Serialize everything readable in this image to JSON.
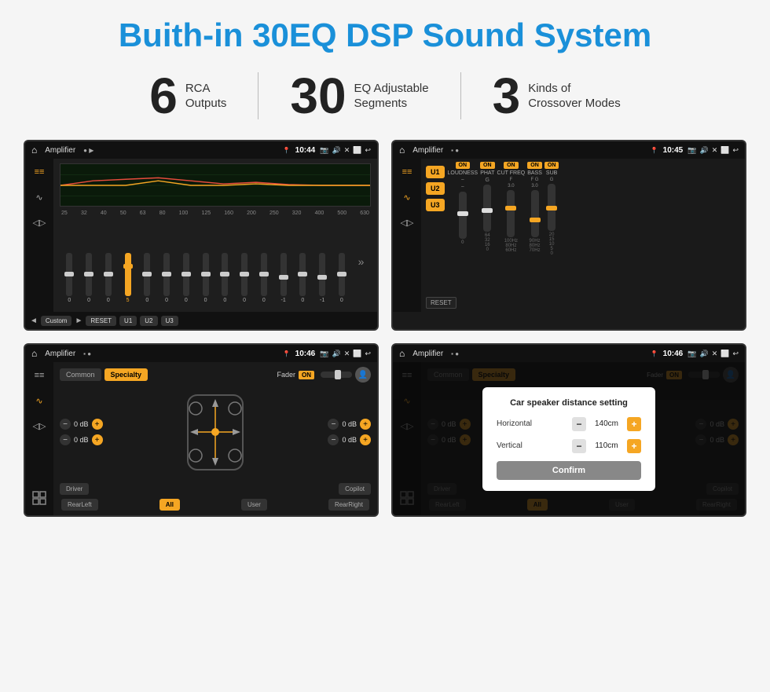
{
  "title": "Buith-in 30EQ DSP Sound System",
  "stats": [
    {
      "number": "6",
      "label": "RCA\nOutputs"
    },
    {
      "number": "30",
      "label": "EQ Adjustable\nSegments"
    },
    {
      "number": "3",
      "label": "Kinds of\nCrossover Modes"
    }
  ],
  "screens": [
    {
      "id": "eq-screen",
      "statusbar": {
        "app": "Amplifier",
        "time": "10:44"
      },
      "eq": {
        "freqs": [
          "25",
          "32",
          "40",
          "50",
          "63",
          "80",
          "100",
          "125",
          "160",
          "200",
          "250",
          "320",
          "400",
          "500",
          "630"
        ],
        "values": [
          "0",
          "0",
          "0",
          "5",
          "0",
          "0",
          "0",
          "0",
          "0",
          "0",
          "0",
          "-1",
          "0",
          "-1"
        ],
        "bottomBtns": [
          "RESET",
          "U1",
          "U2",
          "U3"
        ],
        "presetLabel": "Custom"
      }
    },
    {
      "id": "crossover-screen",
      "statusbar": {
        "app": "Amplifier",
        "time": "10:45"
      },
      "presets": [
        "U1",
        "U2",
        "U3"
      ],
      "controls": [
        {
          "label": "LOUDNESS",
          "on": true
        },
        {
          "label": "PHAT",
          "on": true
        },
        {
          "label": "CUT FREQ",
          "on": true
        },
        {
          "label": "BASS",
          "on": true
        },
        {
          "label": "SUB",
          "on": true
        }
      ],
      "resetLabel": "RESET"
    },
    {
      "id": "fader-screen",
      "statusbar": {
        "app": "Amplifier",
        "time": "10:46"
      },
      "tabs": [
        "Common",
        "Specialty"
      ],
      "activeTab": "Specialty",
      "faderLabel": "Fader",
      "faderOn": "ON",
      "volumes": [
        {
          "value": "0 dB"
        },
        {
          "value": "0 dB"
        },
        {
          "value": "0 dB"
        },
        {
          "value": "0 dB"
        }
      ],
      "bottomBtns": [
        "Driver",
        "",
        "Copilot"
      ],
      "bottomRow": [
        "RearLeft",
        "All",
        "User",
        "RearRight"
      ]
    },
    {
      "id": "distance-screen",
      "statusbar": {
        "app": "Amplifier",
        "time": "10:46"
      },
      "tabs": [
        "Common",
        "Specialty"
      ],
      "activeTab": "Specialty",
      "dialog": {
        "title": "Car speaker distance setting",
        "fields": [
          {
            "label": "Horizontal",
            "value": "140cm"
          },
          {
            "label": "Vertical",
            "value": "110cm"
          }
        ],
        "confirmLabel": "Confirm"
      },
      "volumes": [
        {
          "value": "0 dB"
        },
        {
          "value": "0 dB"
        }
      ],
      "bottomBtns": [
        "Driver",
        "",
        "Copilot"
      ],
      "bottomRow": [
        "RearLeft",
        "All",
        "User",
        "RearRight"
      ]
    }
  ]
}
